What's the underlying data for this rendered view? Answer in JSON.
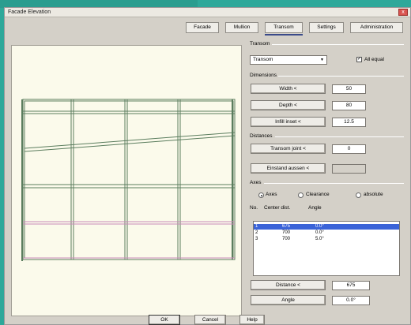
{
  "window": {
    "title": "Facade Elevation",
    "close_label": "x"
  },
  "tabs": [
    {
      "label": "Facade"
    },
    {
      "label": "Mullion"
    },
    {
      "label": "Transom",
      "active": true
    },
    {
      "label": "Settings"
    },
    {
      "label": "Administration"
    }
  ],
  "transom": {
    "section_label": "Transom",
    "type_value": "Transom",
    "all_equal_label": "All equal",
    "all_equal_checked": true
  },
  "dimensions": {
    "section_label": "Dimensions",
    "width_button": "Width <",
    "width_value": "50",
    "depth_button": "Depth <",
    "depth_value": "80",
    "infill_button": "Infill inset <",
    "infill_value": "12.5"
  },
  "distances": {
    "section_label": "Distances",
    "transom_joint_button": "Transom joint <",
    "transom_joint_value": "0",
    "einstand_button": "Einstand aussen <",
    "einstand_value": ""
  },
  "axes": {
    "section_label": "Axes",
    "options": [
      {
        "label": "Axes",
        "selected": true
      },
      {
        "label": "Clearance",
        "selected": false
      },
      {
        "label": "absolute",
        "selected": false
      }
    ],
    "columns": [
      "No.",
      "Center dist.",
      "Angle"
    ],
    "rows": [
      {
        "no": "1",
        "dist": "675",
        "angle": "0.0°"
      },
      {
        "no": "2",
        "dist": "700",
        "angle": "0.0°"
      },
      {
        "no": "3",
        "dist": "700",
        "angle": "5.0°"
      }
    ],
    "selected_row": 0
  },
  "edit": {
    "distance_button": "Distance <",
    "distance_value": "675",
    "angle_button": "Angle",
    "angle_value": "0.0°"
  },
  "footer": {
    "ok": "OK",
    "cancel": "Cancel",
    "help": "Help"
  },
  "colors": {
    "frame_green": "#5b7d5e",
    "transom_pink": "#c88ab8",
    "selection_blue": "#3a63d8"
  }
}
